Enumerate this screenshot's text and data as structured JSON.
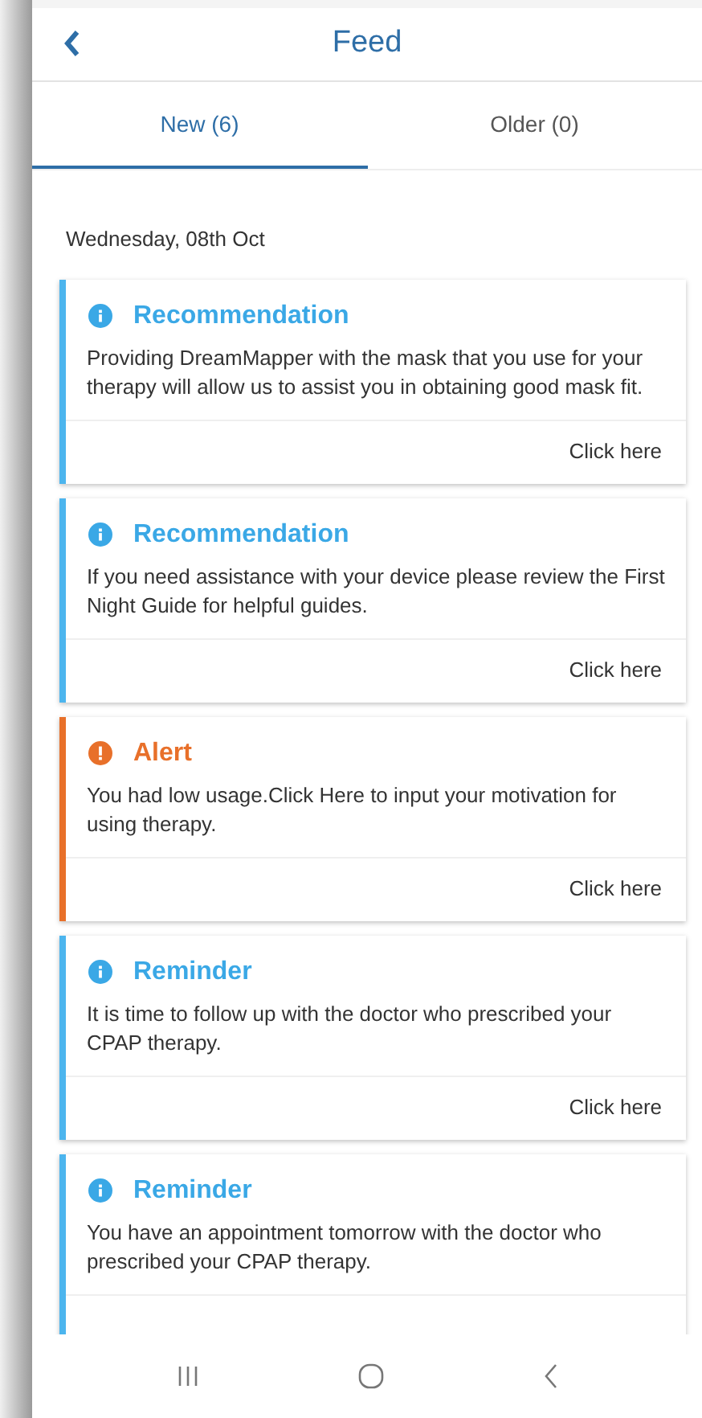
{
  "header": {
    "title": "Feed"
  },
  "tabs": [
    {
      "label": "New (6)",
      "selected": true
    },
    {
      "label": "Older (0)",
      "selected": false
    }
  ],
  "date": "Wednesday, 08th Oct",
  "cards": [
    {
      "kind": "info",
      "title": "Recommendation",
      "body": "Providing DreamMapper with the mask that you use for your therapy will allow us to assist you in obtaining good mask fit.",
      "link": "Click here"
    },
    {
      "kind": "info",
      "title": "Recommendation",
      "body": "If you need assistance with your device please review the First Night Guide for helpful guides.",
      "link": "Click here"
    },
    {
      "kind": "alert",
      "title": "Alert",
      "body": "You had low usage.Click Here to input your motivation for using therapy.",
      "link": "Click here"
    },
    {
      "kind": "info",
      "title": "Reminder",
      "body": "It is time to follow up with the doctor who prescribed your CPAP therapy.",
      "link": "Click here"
    },
    {
      "kind": "info",
      "title": "Reminder",
      "body": "You have an appointment tomorrow with the doctor who prescribed your CPAP therapy."
    }
  ]
}
